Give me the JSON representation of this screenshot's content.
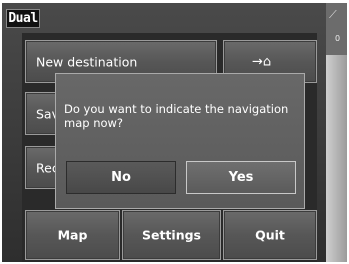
{
  "logo": {
    "text": "Dual"
  },
  "status": {
    "satellite_icon": "satellite-icon",
    "satellite_count": "0"
  },
  "menu": {
    "new_destination": "New destination",
    "home_icon": "→⌂",
    "save_partial": "Sav",
    "recent_partial": "Rec",
    "map": "Map",
    "settings": "Settings",
    "quit": "Quit"
  },
  "dialog": {
    "message": "Do you want to indicate the navigation map now?",
    "no": "No",
    "yes": "Yes"
  }
}
